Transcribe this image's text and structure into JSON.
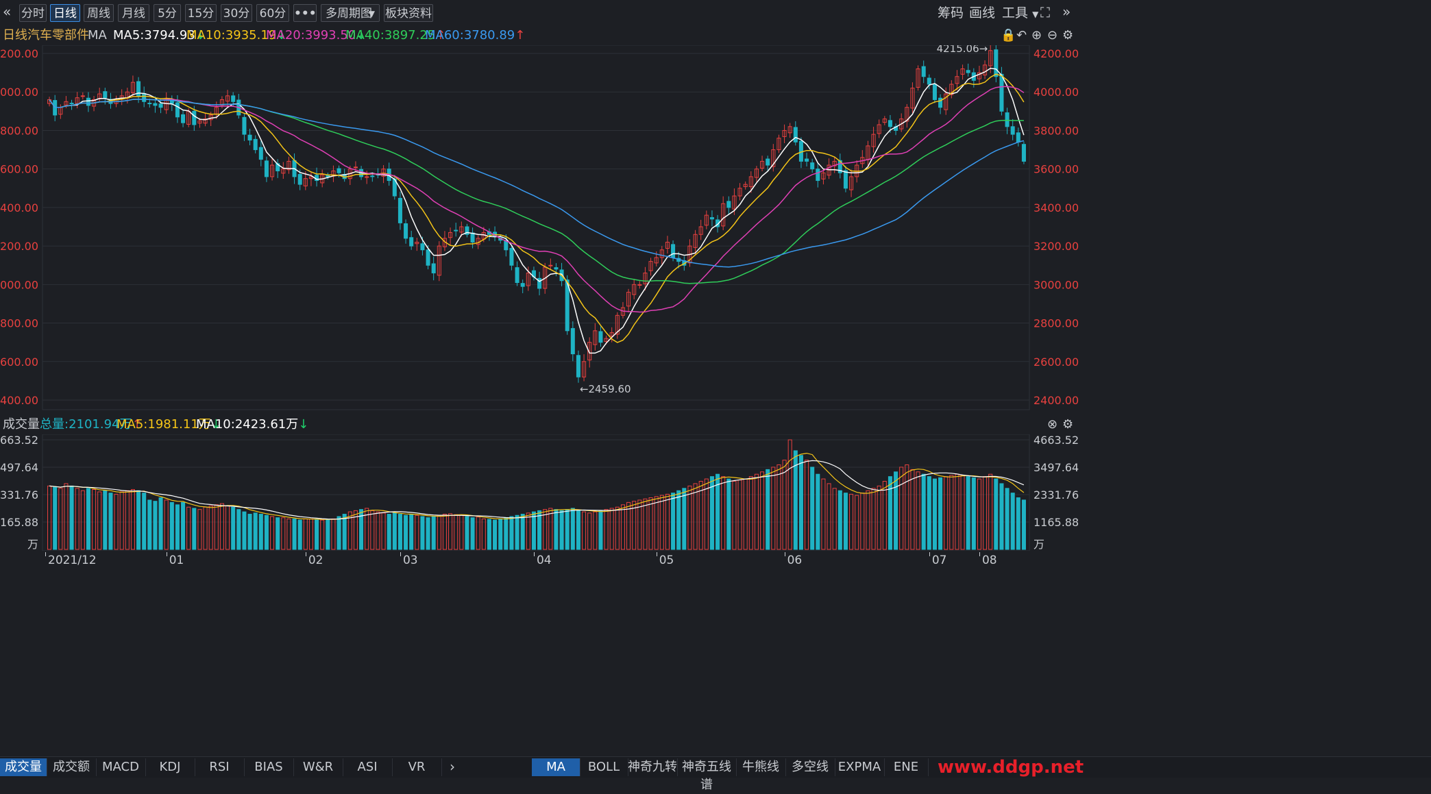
{
  "toolbar": {
    "back_icon": "double-chevron-left-icon",
    "buttons": [
      "分时",
      "日线",
      "周线",
      "月线",
      "5分",
      "15分",
      "30分",
      "60分",
      "•••",
      "多周期图",
      "板块资料"
    ],
    "active": "日线",
    "right": {
      "chips": "筹码",
      "draw": "画线",
      "tools": "工具"
    }
  },
  "legend": {
    "period": "日线",
    "sector": "汽车零部件",
    "indicator": "MA",
    "ma5": "MA5:3794.93",
    "ma10": "MA10:3935.19",
    "ma20": "MA20:3993.50",
    "ma40": "MA40:3897.25",
    "ma60": "MA60:3780.89"
  },
  "price_axis": [
    "4200.00",
    "4000.00",
    "3800.00",
    "3600.00",
    "3400.00",
    "3200.00",
    "3000.00",
    "2800.00",
    "2600.00",
    "2400.00"
  ],
  "annotations": {
    "high": "4215.06→",
    "low": "←2459.60"
  },
  "volume_legend": {
    "title": "成交量",
    "total": "总量:2101.94万",
    "ma5": "MA5:1981.11万",
    "ma10": "MA10:2423.61万"
  },
  "volume_axis": [
    "4663.52",
    "3497.64",
    "2331.76",
    "1165.88",
    "万"
  ],
  "date_axis": [
    "2021/12",
    "01",
    "02",
    "03",
    "04",
    "05",
    "06",
    "07",
    "08"
  ],
  "bottom_tabs_left": [
    "成交量",
    "成交额",
    "MACD",
    "KDJ",
    "RSI",
    "BIAS",
    "W&R",
    "ASI",
    "VR"
  ],
  "bottom_tabs_right": [
    "MA",
    "BOLL",
    "神奇九转",
    "神奇五线谱",
    "牛熊线",
    "多空线",
    "EXPMA",
    "ENE"
  ],
  "watermark": "www.ddgp.net",
  "colors": {
    "up": "#e8413f",
    "down": "#1fb3c4",
    "ma5": "#ffffff",
    "ma10": "#f5c518",
    "ma20": "#e040b5",
    "ma40": "#2fce5a",
    "ma60": "#3a9af0",
    "grid": "#2d3037"
  },
  "chart_data": {
    "type": "candlestick",
    "price_range": [
      2400,
      4200
    ],
    "high": 4215.06,
    "low": 2459.6,
    "closes": [
      3960,
      3880,
      3920,
      3950,
      3940,
      3970,
      3980,
      3930,
      3960,
      3990,
      3970,
      3940,
      3960,
      3980,
      4000,
      4050,
      3980,
      3950,
      3940,
      3930,
      3920,
      3960,
      3940,
      3870,
      3840,
      3900,
      3830,
      3850,
      3860,
      3880,
      3920,
      3960,
      3980,
      3950,
      3880,
      3780,
      3750,
      3700,
      3650,
      3560,
      3620,
      3590,
      3600,
      3640,
      3560,
      3520,
      3550,
      3560,
      3540,
      3570,
      3560,
      3590,
      3580,
      3550,
      3600,
      3610,
      3560,
      3560,
      3560,
      3570,
      3600,
      3540,
      3460,
      3320,
      3240,
      3200,
      3220,
      3180,
      3100,
      3060,
      3200,
      3240,
      3270,
      3280,
      3300,
      3260,
      3220,
      3240,
      3270,
      3260,
      3250,
      3230,
      3180,
      3100,
      3010,
      2990,
      3060,
      3040,
      2980,
      3090,
      3100,
      3080,
      3020,
      2760,
      2640,
      2520,
      2600,
      2700,
      2760,
      2700,
      2720,
      2750,
      2840,
      2880,
      2960,
      3000,
      3000,
      3060,
      3120,
      3140,
      3180,
      3220,
      3140,
      3120,
      3100,
      3200,
      3260,
      3300,
      3360,
      3340,
      3300,
      3420,
      3400,
      3460,
      3500,
      3520,
      3560,
      3600,
      3640,
      3620,
      3700,
      3760,
      3800,
      3820,
      3740,
      3640,
      3640,
      3600,
      3540,
      3580,
      3620,
      3640,
      3580,
      3500,
      3560,
      3620,
      3660,
      3720,
      3780,
      3830,
      3860,
      3820,
      3800,
      3860,
      3920,
      4020,
      4120,
      4080,
      4040,
      3960,
      3920,
      3990,
      4040,
      4080,
      4120,
      4100,
      4060,
      4100,
      4140,
      4215,
      4080,
      3900,
      3820,
      3780,
      3740,
      3640
    ],
    "ma5_last": 3794.93,
    "ma10_last": 3935.19,
    "ma20_last": 3993.5,
    "ma40_last": 3897.25,
    "ma60_last": 3780.89,
    "volume_range": [
      0,
      4663.52
    ],
    "volumes": [
      2700,
      2650,
      2600,
      2800,
      2700,
      2600,
      2500,
      2600,
      2550,
      2450,
      2500,
      2400,
      2350,
      2450,
      2500,
      2550,
      2500,
      2400,
      2100,
      2050,
      2200,
      2100,
      2000,
      1900,
      2000,
      1800,
      1750,
      1700,
      1800,
      1850,
      1900,
      1950,
      1850,
      1800,
      1700,
      1600,
      1500,
      1550,
      1500,
      1450,
      1400,
      1350,
      1350,
      1300,
      1300,
      1250,
      1300,
      1300,
      1280,
      1250,
      1260,
      1300,
      1400,
      1500,
      1600,
      1650,
      1700,
      1750,
      1650,
      1600,
      1550,
      1500,
      1550,
      1500,
      1450,
      1500,
      1450,
      1400,
      1350,
      1400,
      1450,
      1500,
      1520,
      1480,
      1450,
      1400,
      1350,
      1380,
      1300,
      1280,
      1250,
      1300,
      1350,
      1400,
      1450,
      1500,
      1550,
      1600,
      1650,
      1700,
      1750,
      1700,
      1650,
      1700,
      1750,
      1650,
      1600,
      1550,
      1600,
      1650,
      1700,
      1750,
      1800,
      1900,
      2000,
      2050,
      2100,
      2150,
      2200,
      2250,
      2300,
      2350,
      2400,
      2500,
      2600,
      2700,
      2800,
      2900,
      3000,
      3100,
      3200,
      3100,
      3000,
      2900,
      2950,
      3000,
      3100,
      3200,
      3300,
      3400,
      3500,
      3600,
      3800,
      4663,
      4200,
      4000,
      3800,
      3500,
      3200,
      3000,
      2800,
      2600,
      2500,
      2400,
      2350,
      2300,
      2400,
      2500,
      2600,
      2700,
      2900,
      3100,
      3300,
      3500,
      3600,
      3400,
      3300,
      3200,
      3100,
      3000,
      3050,
      3100,
      3150,
      3200,
      3150,
      3100,
      3050,
      3000,
      3100,
      3200,
      3000,
      2800,
      2600,
      2400,
      2200,
      2101.94
    ]
  }
}
